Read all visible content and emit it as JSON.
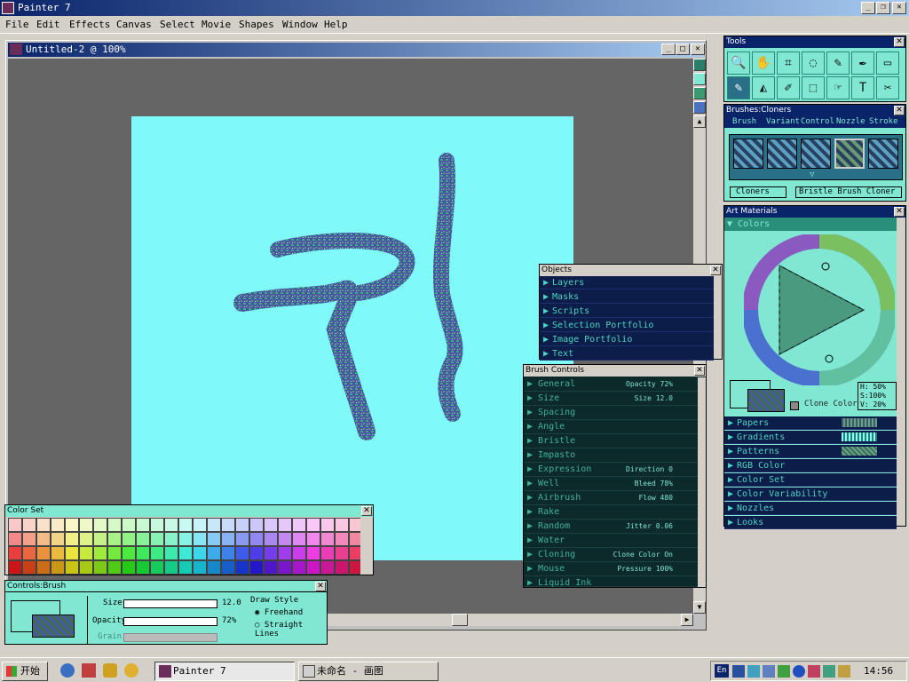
{
  "app": {
    "title": "Painter 7"
  },
  "menu": [
    "File",
    "Edit",
    "Effects",
    "Canvas",
    "Select",
    "Movie",
    "Shapes",
    "Window",
    "Help"
  ],
  "document": {
    "title": "Untitled-2 @ 100%"
  },
  "tools_palette": {
    "title": "Tools",
    "tools": [
      "magnifier-icon",
      "grabber-icon",
      "crop-icon",
      "lasso-icon",
      "brush-icon",
      "pen-icon",
      "rectangle-icon",
      "dropper-icon",
      "paint-bucket-icon",
      "eyedropper-icon",
      "rect-select-icon",
      "layer-adjuster-icon",
      "text-icon",
      "scissors-icon"
    ]
  },
  "brushes_palette": {
    "title": "Brushes:Cloners",
    "tabs": [
      "Brush",
      "Variant",
      "Control",
      "Nozzle",
      "Stroke"
    ],
    "category": "Cloners",
    "variant": "Bristle Brush Cloner"
  },
  "art_materials": {
    "title": "Art Materials",
    "colors_label": "Colors",
    "hsv": {
      "h": "H: 50%",
      "s": "S:100%",
      "v": "V: 20%"
    },
    "clone_color": "Clone Color",
    "sections": [
      "Papers",
      "Gradients",
      "Patterns",
      "RGB Color",
      "Color Set",
      "Color Variability",
      "Nozzles",
      "Looks"
    ]
  },
  "objects_palette": {
    "title": "Objects",
    "items": [
      "Layers",
      "Masks",
      "Scripts",
      "Selection Portfolio",
      "Image Portfolio",
      "Text"
    ]
  },
  "brush_controls": {
    "title": "Brush Controls",
    "items": [
      {
        "label": "General",
        "value": "Opacity 72%"
      },
      {
        "label": "Size",
        "value": "Size 12.0"
      },
      {
        "label": "Spacing",
        "value": ""
      },
      {
        "label": "Angle",
        "value": ""
      },
      {
        "label": "Bristle",
        "value": ""
      },
      {
        "label": "Impasto",
        "value": ""
      },
      {
        "label": "Expression",
        "value": "Direction 0"
      },
      {
        "label": "Well",
        "value": "Bleed 78%"
      },
      {
        "label": "Airbrush",
        "value": "Flow 480"
      },
      {
        "label": "Rake",
        "value": ""
      },
      {
        "label": "Random",
        "value": "Jitter 0.06"
      },
      {
        "label": "Water",
        "value": ""
      },
      {
        "label": "Cloning",
        "value": "Clone Color On"
      },
      {
        "label": "Mouse",
        "value": "Pressure 100%"
      },
      {
        "label": "Liquid Ink",
        "value": ""
      }
    ]
  },
  "color_set": {
    "title": "Color Set"
  },
  "controls_brush": {
    "title": "Controls:Brush",
    "size_label": "Size",
    "size_value": "12.0",
    "opacity_label": "Opacity",
    "opacity_value": "72%",
    "grain_label": "Grain",
    "draw_style_label": "Draw Style",
    "freehand": "Freehand",
    "straight": "Straight Lines"
  },
  "taskbar": {
    "start": "开始",
    "tasks": [
      "Painter 7",
      "未命名 - 画图"
    ],
    "lang": "En",
    "clock": "14:56"
  }
}
